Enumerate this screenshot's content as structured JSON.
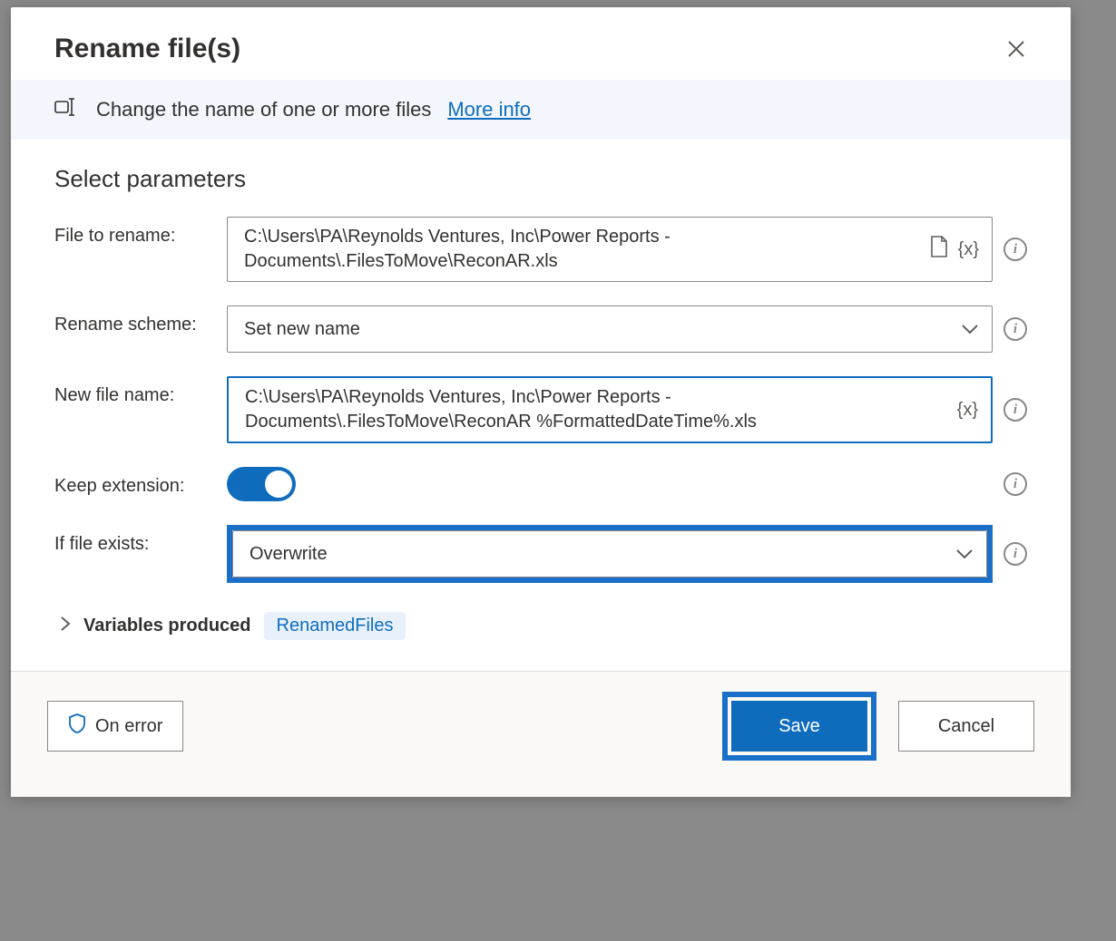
{
  "dialog": {
    "title": "Rename file(s)",
    "banner_text": "Change the name of one or more files",
    "banner_link": "More info"
  },
  "section": {
    "title": "Select parameters"
  },
  "fields": {
    "file_to_rename": {
      "label": "File to rename:",
      "value": "C:\\Users\\PA\\Reynolds Ventures, Inc\\Power Reports - Documents\\.FilesToMove\\ReconAR.xls"
    },
    "rename_scheme": {
      "label": "Rename scheme:",
      "value": "Set new name"
    },
    "new_file_name": {
      "label": "New file name:",
      "value": "C:\\Users\\PA\\Reynolds Ventures, Inc\\Power Reports - Documents\\.FilesToMove\\ReconAR %FormattedDateTime%.xls"
    },
    "keep_extension": {
      "label": "Keep extension:",
      "value": true
    },
    "if_file_exists": {
      "label": "If file exists:",
      "value": "Overwrite"
    }
  },
  "variables": {
    "label": "Variables produced",
    "chip": "RenamedFiles"
  },
  "footer": {
    "on_error": "On error",
    "save": "Save",
    "cancel": "Cancel"
  },
  "icons": {
    "variable_token": "{x}"
  }
}
